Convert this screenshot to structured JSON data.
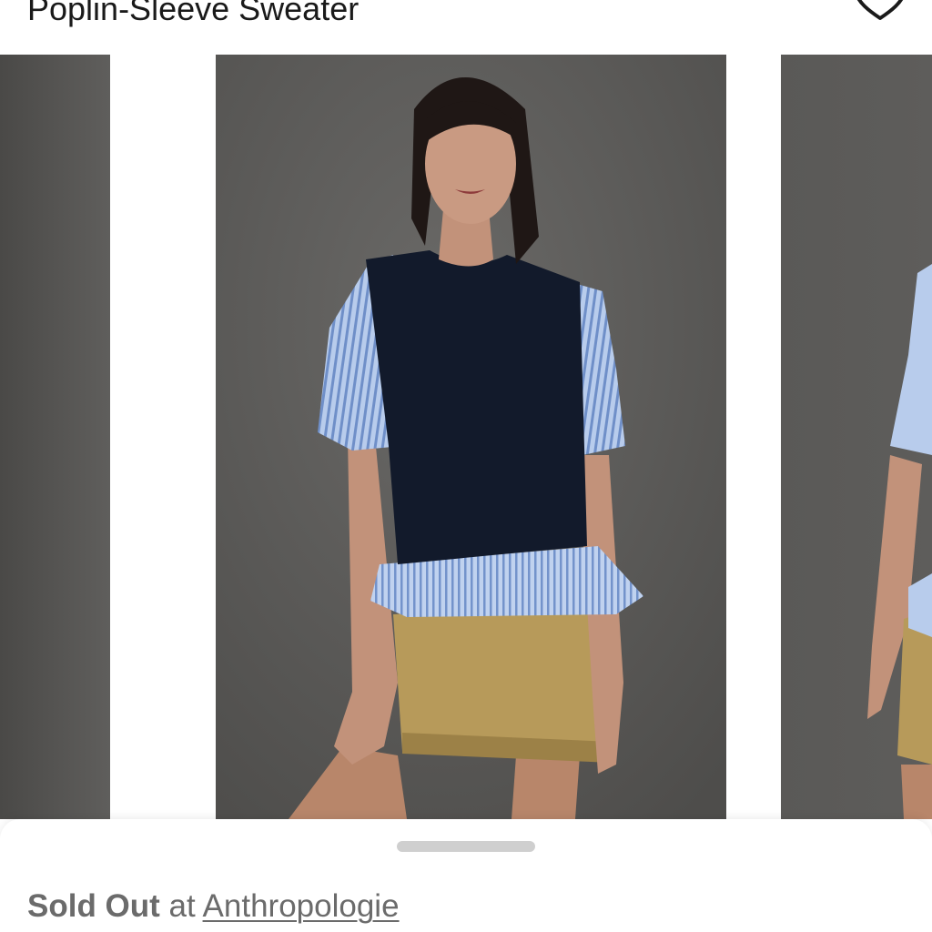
{
  "product": {
    "title": "Poplin-Sleeve Sweater"
  },
  "icons": {
    "favorite": "heart-outline-icon"
  },
  "carousel": {
    "slide_count_visible": 3,
    "selected_index": 1
  },
  "availability": {
    "status": "Sold Out",
    "connector": "at",
    "store": "Anthropologie"
  },
  "colors": {
    "backdrop": "#5b5a58",
    "sweater": "#121a2b",
    "poplin_stripe": "#a9c1e8",
    "skirt": "#b79a5a",
    "status_text": "#6b6b6b"
  }
}
